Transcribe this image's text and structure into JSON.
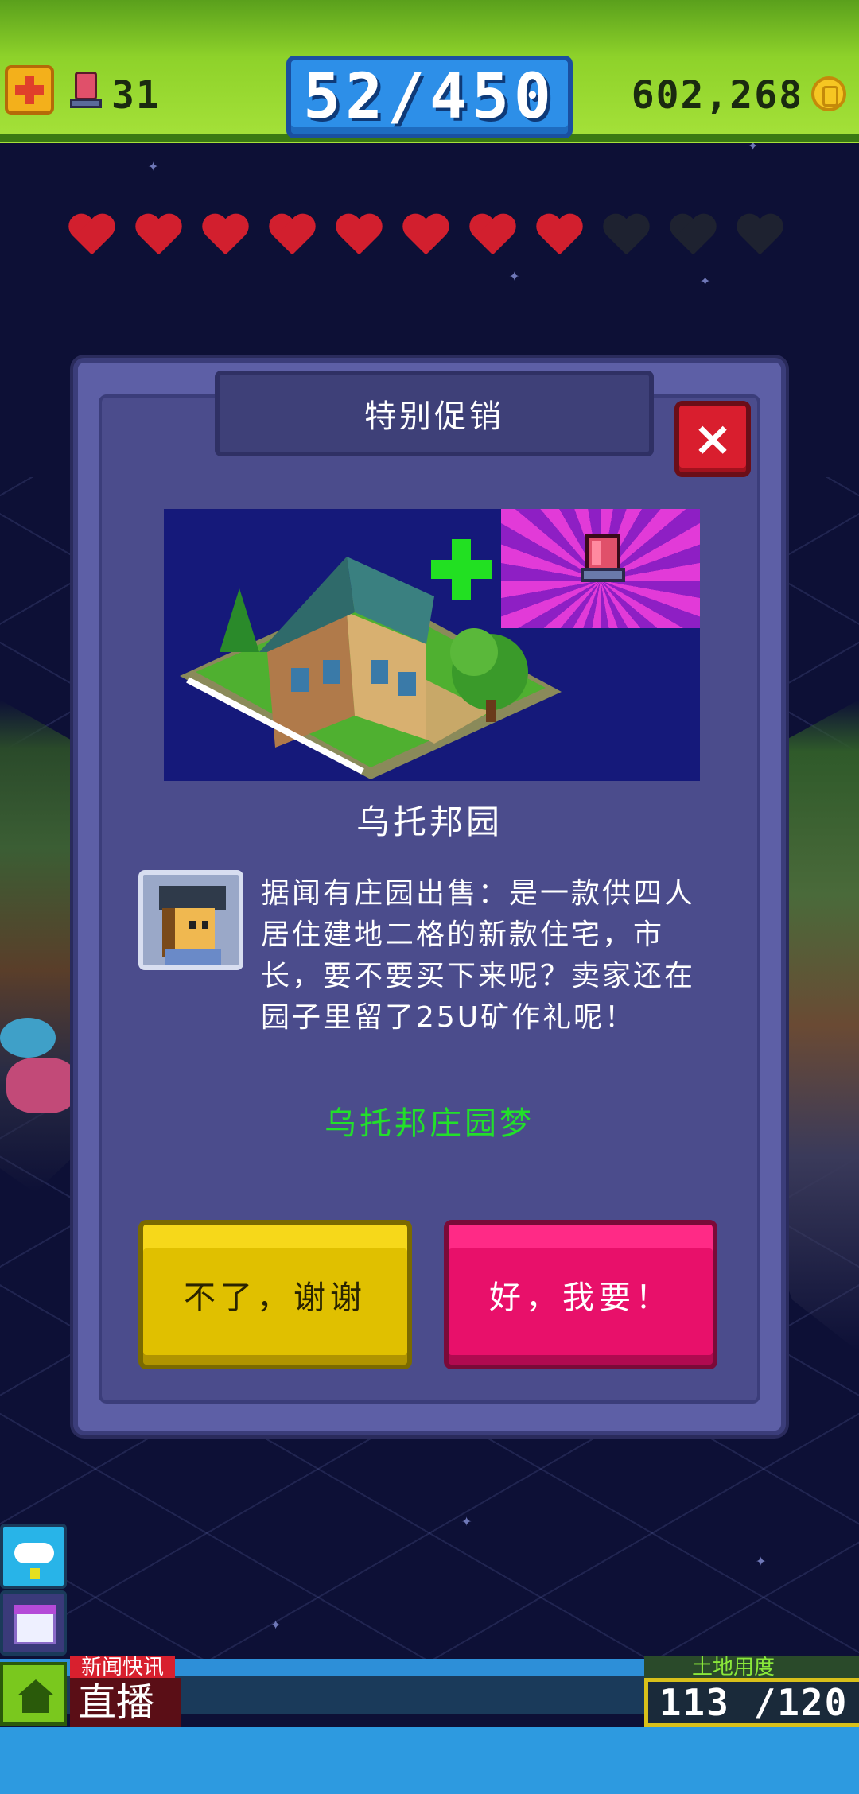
{
  "topbar": {
    "bux_count": "31",
    "population": "52/450",
    "coins": "602,268"
  },
  "hearts": {
    "full": 8,
    "total": 11
  },
  "dialog": {
    "title": "特别促销",
    "close_label": "×",
    "item_name": "乌托邦园",
    "description": "据闻有庄园出售：是一款供四人居住建地二格的新款住宅，市长，要不要买下来呢？卖家还在园子里留了25U矿作礼呢！",
    "offer_name": "乌托邦庄园梦",
    "decline_label": "不了，谢谢",
    "accept_label": "好，我要！"
  },
  "bottom": {
    "news_label": "新闻快讯",
    "live_label": "直播",
    "land_label": "土地用度",
    "land_usage": "113 /120"
  },
  "colors": {
    "accent_green": "#22e02a",
    "close_red": "#d91e2e",
    "decline_yellow": "#e0c000",
    "accept_pink": "#e8106a",
    "dialog_purple": "#5d5fa6"
  },
  "icons": [
    "plus-icon",
    "bux-icon",
    "coin-icon",
    "heart-icon",
    "close-icon",
    "cloud-icon",
    "calendar-icon",
    "home-icon"
  ]
}
